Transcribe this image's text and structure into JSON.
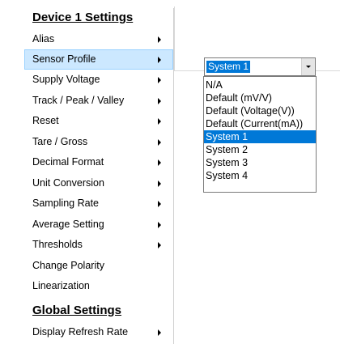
{
  "menu": {
    "heading_device": "Device 1 Settings",
    "items": [
      {
        "label": "Alias",
        "arrow": true
      },
      {
        "label": "Sensor Profile",
        "arrow": true
      },
      {
        "label": "Supply Voltage",
        "arrow": true
      },
      {
        "label": "Track / Peak / Valley",
        "arrow": true
      },
      {
        "label": "Reset",
        "arrow": true
      },
      {
        "label": "Tare / Gross",
        "arrow": true
      },
      {
        "label": "Decimal Format",
        "arrow": true
      },
      {
        "label": "Unit Conversion",
        "arrow": true
      },
      {
        "label": "Sampling Rate",
        "arrow": true
      },
      {
        "label": "Average Setting",
        "arrow": true
      },
      {
        "label": "Thresholds",
        "arrow": true
      },
      {
        "label": "Change Polarity",
        "arrow": false
      },
      {
        "label": "Linearization",
        "arrow": false
      }
    ],
    "heading_global": "Global Settings",
    "global_items": [
      {
        "label": "Display Refresh Rate",
        "arrow": true
      }
    ],
    "active_item": "Sensor Profile"
  },
  "combo": {
    "selected": "System 1",
    "options": [
      "N/A",
      "Default (mV/V)",
      "Default (Voltage(V))",
      "Default (Current(mA))",
      "System 1",
      "System 2",
      "System 3",
      "System 4"
    ]
  },
  "colors": {
    "menu_highlight": "#cce8ff",
    "selection": "#0078d7"
  },
  "icons": {
    "submenu_arrow": "submenu-arrow-icon",
    "dropdown": "chevron-down-icon"
  }
}
